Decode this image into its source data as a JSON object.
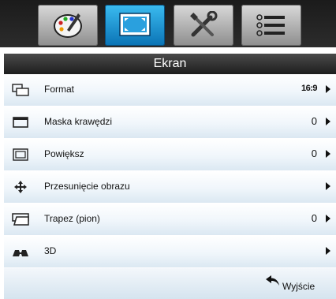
{
  "tabs": [
    {
      "name": "palette-icon",
      "active": false
    },
    {
      "name": "screen-icon",
      "active": true
    },
    {
      "name": "tools-icon",
      "active": false
    },
    {
      "name": "list-icon",
      "active": false
    }
  ],
  "menu_title": "Ekran",
  "items": [
    {
      "label": "Format",
      "value": "16:9",
      "icon": "format-icon"
    },
    {
      "label": "Maska krawędzi",
      "value": "0",
      "icon": "edge-mask-icon"
    },
    {
      "label": "Powiększ",
      "value": "0",
      "icon": "zoom-icon"
    },
    {
      "label": "Przesunięcie obrazu",
      "value": "",
      "icon": "image-shift-icon"
    },
    {
      "label": "Trapez (pion)",
      "value": "0",
      "icon": "keystone-icon"
    },
    {
      "label": "3D",
      "value": "",
      "icon": "3d-glasses-icon"
    }
  ],
  "footer": {
    "exit_label": "Wyjście",
    "exit_icon": "return-arrow-icon"
  },
  "colors": {
    "active_tab": "#1e97d8",
    "title_bar": "#2b2b2b"
  }
}
